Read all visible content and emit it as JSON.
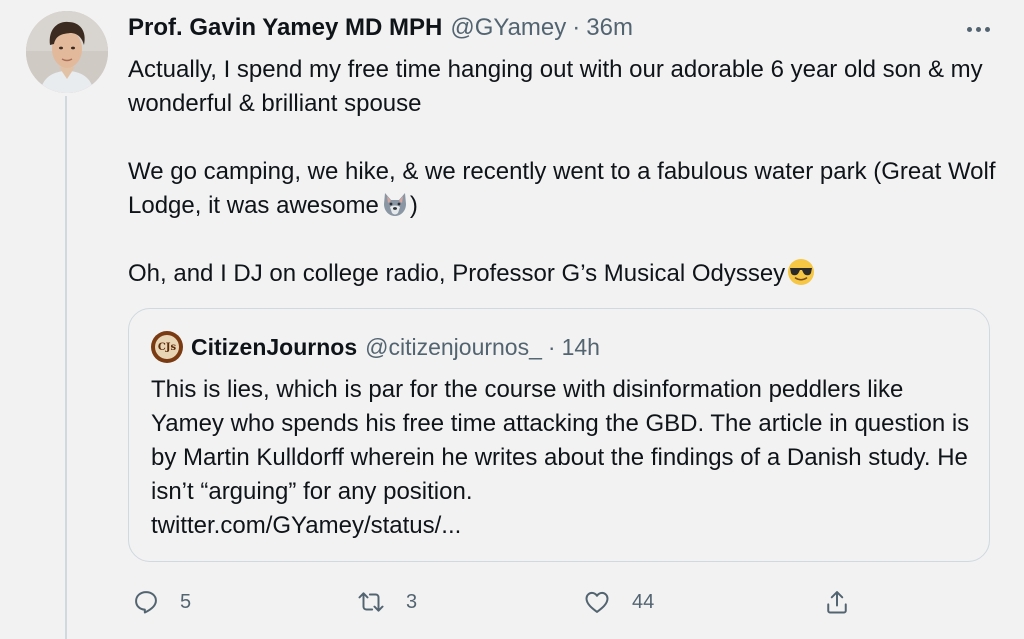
{
  "author": {
    "display_name": "Prof. Gavin Yamey MD MPH",
    "handle": "@GYamey",
    "separator": "·",
    "time": "36m"
  },
  "tweet": {
    "line1": "Actually, I spend my free time hanging out with our adorable 6 year old son & my wonderful & brilliant spouse",
    "line2": "We go camping, we hike, & we recently went to a fabulous water park (Great Wolf Lodge, it was awesome",
    "line2_end": ")",
    "line3": "Oh, and I DJ on college radio, Professor G’s Musical Odyssey",
    "emojis": [
      "wolf-emoji",
      "sunglasses-emoji"
    ]
  },
  "quote": {
    "display_name": "CitizenJournos",
    "handle": "@citizenjournos_",
    "separator": "·",
    "time": "14h",
    "avatar_text": "CJs",
    "text": "This is lies, which is par for the course with disinformation peddlers like Yamey who spends his free time attacking the GBD. The article in question is by Martin Kulldorff wherein he writes about the findings of a Danish study. He isn’t “arguing” for any position.",
    "link": "twitter.com/GYamey/status/..."
  },
  "actions": {
    "reply_count": "5",
    "retweet_count": "3",
    "like_count": "44"
  },
  "icons": {
    "more": "more-horizontal-icon",
    "reply": "reply-icon",
    "retweet": "retweet-icon",
    "like": "heart-icon",
    "share": "share-icon"
  },
  "colors": {
    "background": "#f2f2f2",
    "text": "#0f1419",
    "secondary": "#536471",
    "border": "#cfd9de"
  }
}
